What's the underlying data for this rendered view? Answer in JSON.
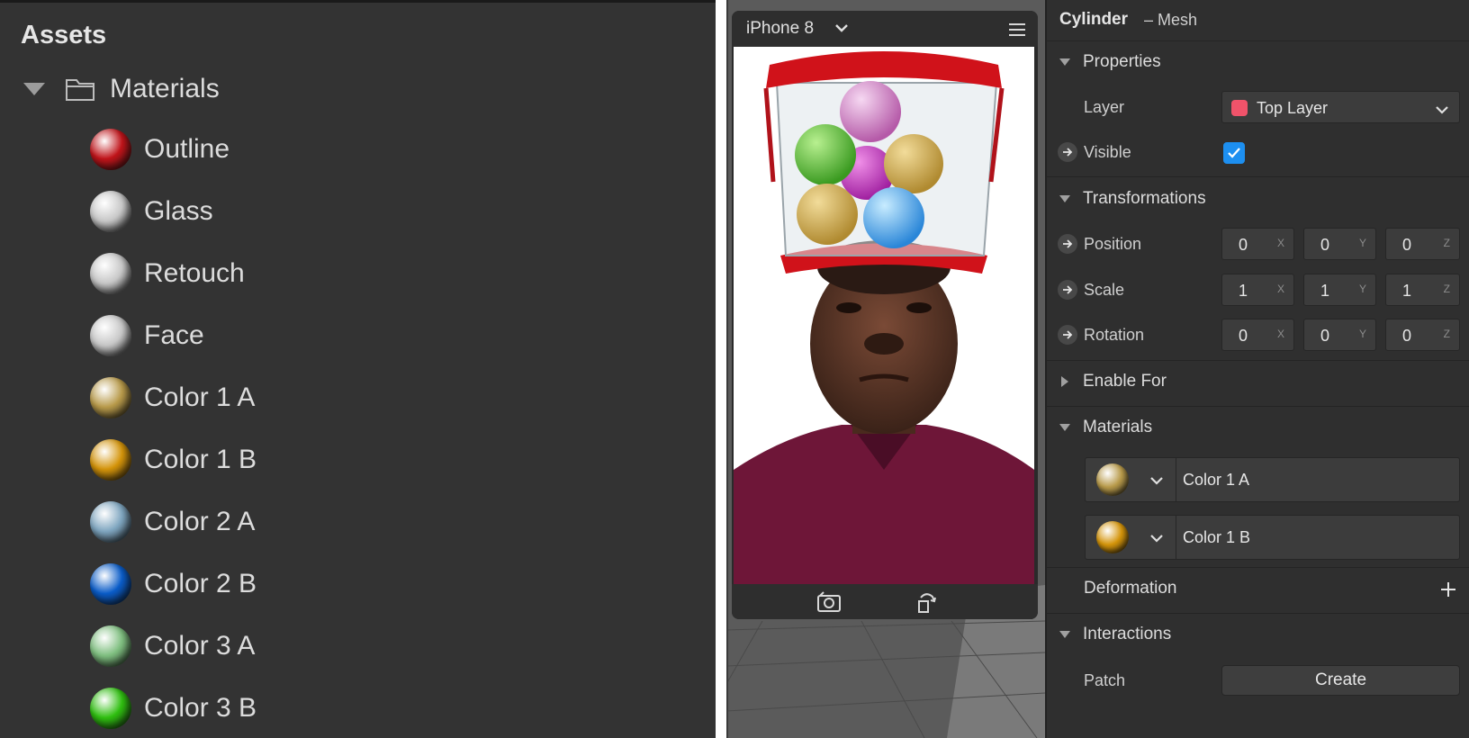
{
  "assets": {
    "title": "Assets",
    "folder": "Materials",
    "items": [
      {
        "label": "Outline",
        "color": "#c0141a"
      },
      {
        "label": "Glass",
        "color": "#c8c8c8"
      },
      {
        "label": "Retouch",
        "color": "#c8c8c8"
      },
      {
        "label": "Face",
        "color": "#c8c8c8"
      },
      {
        "label": "Color 1 A",
        "color": "#b89a4a"
      },
      {
        "label": "Color 1 B",
        "color": "#d4940a"
      },
      {
        "label": "Color 2 A",
        "color": "#7fa6c0"
      },
      {
        "label": "Color 2 B",
        "color": "#0a5cc8"
      },
      {
        "label": "Color 3 A",
        "color": "#7fbf80"
      },
      {
        "label": "Color 3 B",
        "color": "#2fbf10"
      }
    ]
  },
  "viewport": {
    "device": "iPhone 8"
  },
  "inspector": {
    "object_name": "Cylinder",
    "object_type": "– Mesh",
    "sections": {
      "properties": "Properties",
      "transformations": "Transformations",
      "enable_for": "Enable For",
      "materials": "Materials",
      "deformation": "Deformation",
      "interactions": "Interactions"
    },
    "layer": {
      "label": "Layer",
      "value": "Top Layer",
      "swatch": "#f0536a"
    },
    "visible": {
      "label": "Visible",
      "checked": true
    },
    "position": {
      "label": "Position",
      "x": "0",
      "y": "0",
      "z": "0"
    },
    "scale": {
      "label": "Scale",
      "x": "1",
      "y": "1",
      "z": "1"
    },
    "rotation": {
      "label": "Rotation",
      "x": "0",
      "y": "0",
      "z": "0"
    },
    "axes": {
      "x": "X",
      "y": "Y",
      "z": "Z"
    },
    "material_slots": [
      {
        "name": "Color 1 A",
        "color": "#b89a4a"
      },
      {
        "name": "Color 1 B",
        "color": "#d4940a"
      }
    ],
    "patch": {
      "label": "Patch",
      "button": "Create"
    }
  }
}
